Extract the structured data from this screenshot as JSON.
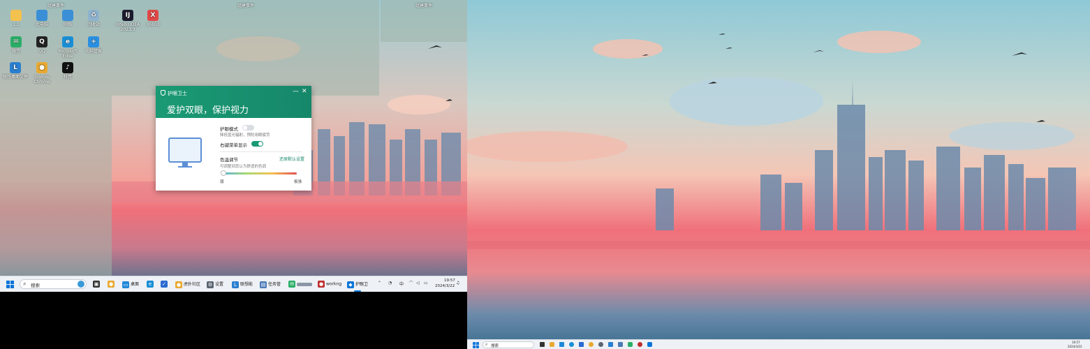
{
  "colors": {
    "accent_green": "#1a9a74",
    "taskbar_bg": "#eef1f5",
    "windows_blue": "#0a74d8",
    "sky_top": "#8fc9d6",
    "sunset_pink": "#f0707a",
    "water_blue": "#3a6d8e"
  },
  "desktop": {
    "top_captions": [
      "组建事件",
      "组建事件",
      "组建事件"
    ],
    "icons": [
      {
        "label": "1.1",
        "icon": "folder-icon",
        "color": "#f2c14e",
        "glyph": ""
      },
      {
        "label": "此电脑",
        "icon": "computer-icon",
        "color": "#3a8fd6",
        "glyph": ""
      },
      {
        "label": "网络",
        "icon": "network-icon",
        "color": "#3a8fd6",
        "glyph": ""
      },
      {
        "label": "回收站",
        "icon": "recycle-bin-icon",
        "color": "#8fb3cf",
        "glyph": "♻"
      },
      {
        "label": "IntelliJ IDEA 2023.3",
        "icon": "intellij-icon",
        "color": "#1b1b2e",
        "glyph": "IJ"
      },
      {
        "label": "XMind",
        "icon": "xmind-icon",
        "color": "#e04848",
        "glyph": "X"
      },
      {
        "label": "微信",
        "icon": "wechat-icon",
        "color": "#2aae67",
        "glyph": "✉"
      },
      {
        "label": "QQ",
        "icon": "qq-icon",
        "color": "#222222",
        "glyph": "Q"
      },
      {
        "label": "Microsoft Edge",
        "icon": "edge-icon",
        "color": "#1a8fd6",
        "glyph": "e"
      },
      {
        "label": "电脑管家",
        "icon": "pc-manager-icon",
        "color": "#2a8fe0",
        "glyph": "+"
      },
      {
        "label": "联想桌面文件",
        "icon": "lenovo-files-icon",
        "color": "#2a7fd0",
        "glyph": "L"
      },
      {
        "label": "Google Chrome",
        "icon": "chrome-icon",
        "color": "#e9a930",
        "glyph": "●"
      },
      {
        "label": "抖音",
        "icon": "douyin-icon",
        "color": "#111111",
        "glyph": "♪"
      }
    ]
  },
  "eye_guard": {
    "window_title": "护眼卫士",
    "minimize_symbol": "—",
    "close_symbol": "✕",
    "slogan": "爱护双眼，保护视力",
    "eye_mode_label": "护眼模式",
    "eye_mode_desc": "降低蓝光辐射，预防用眼疲劳",
    "eye_mode_on": false,
    "context_menu_label": "右键菜单显示",
    "context_menu_on": true,
    "color_temp_label": "色温调节",
    "color_temp_desc": "可调整到您认为舒适的色调",
    "restore_default": "还原默认设置",
    "slider_min_label": "弱",
    "slider_max_label": "极强",
    "slider_value": 0.0
  },
  "taskbar_left": {
    "search_placeholder": "搜索",
    "items": [
      {
        "label": "",
        "icon": "task-view-icon",
        "color": "#333333",
        "glyph": "▣"
      },
      {
        "label": "",
        "icon": "notify-app-icon",
        "color": "#e9a930",
        "glyph": "●"
      },
      {
        "label": "桌面",
        "icon": "folder-icon",
        "color": "#1e88d8",
        "glyph": "▭"
      },
      {
        "label": "",
        "icon": "edge-icon",
        "color": "#1a8fd6",
        "glyph": "e"
      },
      {
        "label": "",
        "icon": "todo-icon",
        "color": "#2a6ad0",
        "glyph": "✓"
      },
      {
        "label": "虎扑社区",
        "icon": "chrome-icon",
        "color": "#e9a930",
        "glyph": "●"
      },
      {
        "label": "设置",
        "icon": "gear-icon",
        "color": "#5b6470",
        "glyph": "⚙"
      },
      {
        "label": "联想能",
        "icon": "lenovo-vantage-icon",
        "color": "#2a7fd0",
        "glyph": "L"
      },
      {
        "label": "任务管",
        "icon": "task-manager-icon",
        "color": "#4a7ab8",
        "glyph": "▤"
      },
      {
        "label": "",
        "icon": "wechat-icon",
        "color": "#2aae67",
        "glyph": "✉"
      },
      {
        "label": "workng",
        "icon": "app-icon",
        "color": "#c03030",
        "glyph": "●"
      },
      {
        "label": "护眼卫",
        "icon": "shield-icon",
        "color": "#0a74d8",
        "glyph": "◆"
      }
    ],
    "tray_language": "中",
    "tray_time": "19:57",
    "tray_date": "2024/3/22"
  },
  "taskbar_right": {
    "search_placeholder": "搜索",
    "tray_time": "19:57",
    "tray_date": "2024/3/22"
  }
}
